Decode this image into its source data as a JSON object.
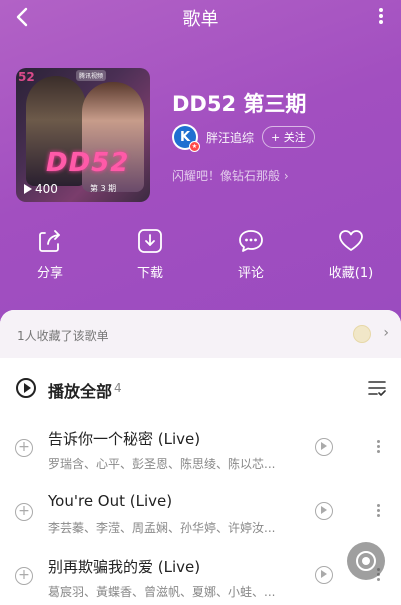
{
  "header": {
    "title": "歌单"
  },
  "playlist": {
    "name": "DD52 第三期",
    "creator": "胖汪追综",
    "follow_label": "+ 关注",
    "description": "闪耀吧！像钻石那般 ›",
    "play_count": "400",
    "cover": {
      "logo_text": "DD52",
      "sub_text": "第 3 期",
      "badge_text": "腾讯视频",
      "corner_text": "52"
    }
  },
  "actions": [
    {
      "label": "分享",
      "icon": "share-icon"
    },
    {
      "label": "下载",
      "icon": "download-icon"
    },
    {
      "label": "评论",
      "icon": "comment-icon"
    },
    {
      "label": "收藏(1)",
      "icon": "heart-icon"
    }
  ],
  "collect_bar": {
    "text": "1人收藏了该歌单"
  },
  "play_all": {
    "label": "播放全部",
    "count": "4"
  },
  "songs": [
    {
      "title": "告诉你一个秘密 (Live)",
      "artists": "罗瑞含、心平、彭圣恩、陈思绫、陈以芯..."
    },
    {
      "title": "You're Out (Live)",
      "artists": "李芸蓁、李滢、周孟娴、孙华婷、许婷汝..."
    },
    {
      "title": "别再欺骗我的爱 (Live)",
      "artists": "葛宸羽、黃蝶香、曾滋帆、夏娜、小蛙、..."
    }
  ],
  "colors": {
    "hero_start": "#b262c6",
    "hero_end": "#9a4bbf",
    "panel_bg": "#ffffff"
  }
}
